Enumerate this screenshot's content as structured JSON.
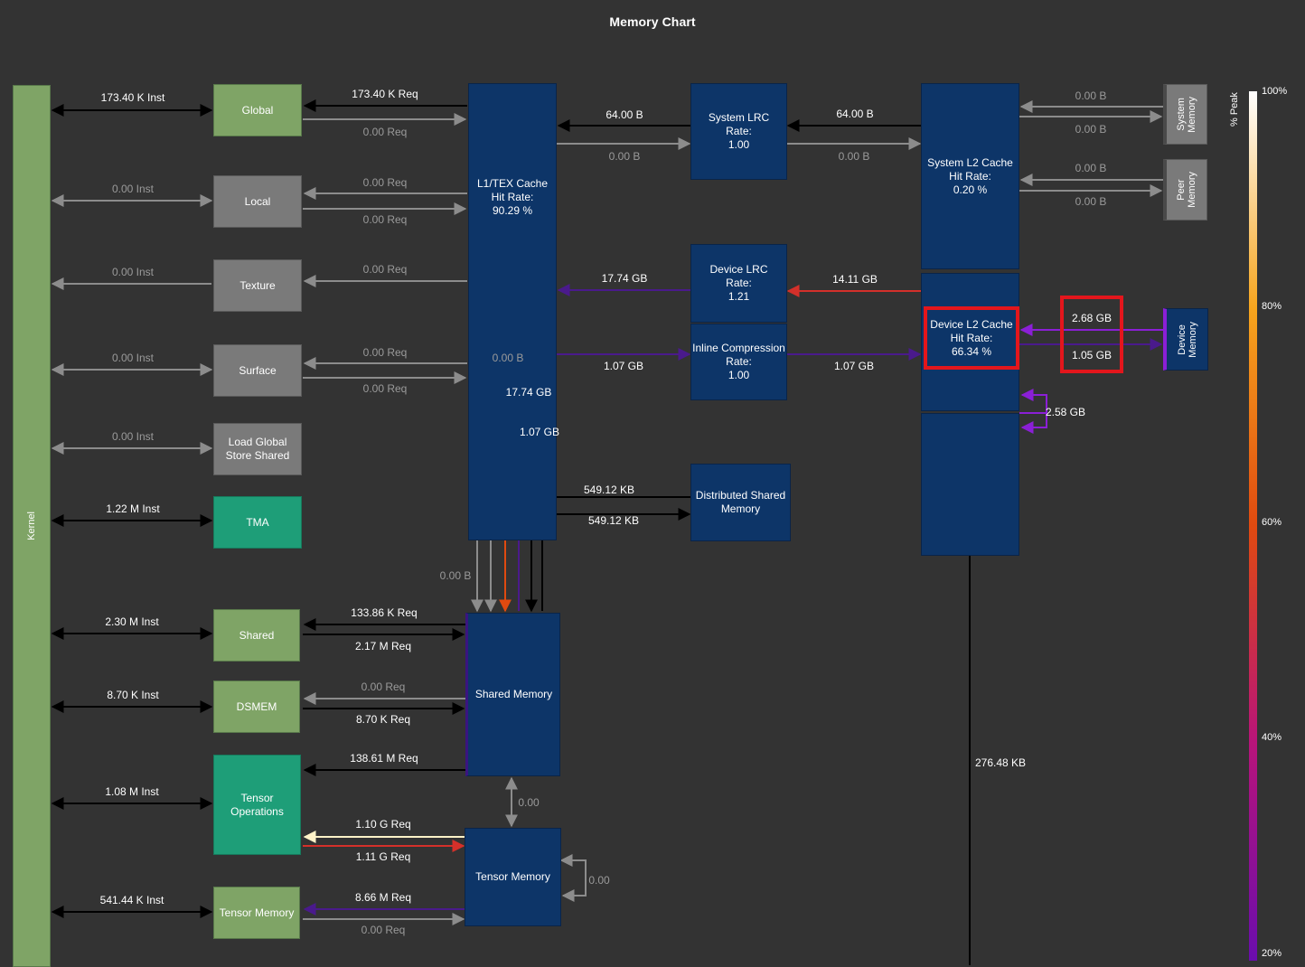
{
  "title": "Memory Chart",
  "colors": {
    "background": "#333333",
    "black": "#000000",
    "gray": "#8c8c8c",
    "purple": "#4a1a8c",
    "violet": "#8b1fd6",
    "red": "#d4302a",
    "orange": "#e04a10",
    "cream": "#fff3c8",
    "highlight": "#e3161c"
  },
  "units": {
    "nodes": [
      {
        "label": "Kernel"
      },
      {
        "label": "Global"
      },
      {
        "label": "Local"
      },
      {
        "label": "Texture"
      },
      {
        "label": "Surface"
      },
      {
        "label": "Load Global\nStore Shared"
      },
      {
        "label": "TMA"
      },
      {
        "label": "Shared"
      },
      {
        "label": "DSMEM"
      },
      {
        "label": "Tensor\nOperations"
      },
      {
        "label": "Tensor Memory"
      }
    ]
  },
  "caches": {
    "l1tex": "L1/TEX Cache\nHit Rate:\n90.29 %",
    "sys_lrc": "System LRC\nRate:\n1.00",
    "dev_lrc": "Device LRC\nRate:\n1.21",
    "inline": "Inline Compression\nRate:\n1.00",
    "dsm": "Distributed Shared\nMemory",
    "sys_l2": "System L2 Cache\nHit Rate:\n0.20 %",
    "dev_l2": "Device L2 Cache\nHit Rate:\n66.34 %",
    "shared_mem": "Shared Memory",
    "tensor_mem": "Tensor Memory",
    "system_memory": "System\nMemory",
    "peer_memory": "Peer\nMemory",
    "device_memory": "Device\nMemory"
  },
  "labels": {
    "global_inst": "173.40 K Inst",
    "global_req": "173.40 K Req",
    "global_req_w": "0.00  Req",
    "local_inst": "0.00  Inst",
    "local_req_r": "0.00  Req",
    "local_req_w": "0.00  Req",
    "tex_inst": "0.00  Inst",
    "tex_req": "0.00  Req",
    "surf_inst": "0.00  Inst",
    "surf_req_r": "0.00  Req",
    "surf_req_w": "0.00  Req",
    "lgss_inst": "0.00  Inst",
    "tma_inst": "1.22 M Inst",
    "shared_inst": "2.30 M Inst",
    "shared_req_r": "133.86 K Req",
    "shared_req_w": "2.17 M Req",
    "dsmem_inst": "8.70 K Inst",
    "dsmem_req_r": "0.00  Req",
    "dsmem_req_w": "8.70 K Req",
    "tops_inst": "1.08 M Inst",
    "tops_req1": "138.61 M Req",
    "tops_req2": "1.10 G Req",
    "tops_req3": "1.11 G Req",
    "tmem_inst": "541.44 K Inst",
    "tmem_req_r": "8.66 M Req",
    "tmem_req_w": "0.00  Req",
    "l1_sys_r": "64.00 B",
    "l1_sys_w": "0.00 B",
    "sys_l2_r": "64.00 B",
    "sys_l2_w": "0.00 B",
    "sysmem_r": "0.00 B",
    "sysmem_w": "0.00 B",
    "peer_r": "0.00 B",
    "peer_w": "0.00 B",
    "l1_devlrc": "17.74 GB",
    "devlrc_l2": "14.11 GB",
    "l1_inline": "1.07 GB",
    "inline_l2": "1.07 GB",
    "l1_inner_b": "0.00 B",
    "l1_inner_gb1": "17.74 GB",
    "l1_inner_gb2": "1.07 GB",
    "dsm_in": "549.12 KB",
    "dsm_out": "549.12 KB",
    "l1_shared": "0.00 B",
    "devmem_r": "2.68 GB",
    "devmem_w": "1.05 GB",
    "l2_loop": "2.58 GB",
    "l2_down": "276.48 KB",
    "shm_tmem": "0.00",
    "tmem_loop": "0.00"
  },
  "colorbar": {
    "title": "% Peak",
    "ticks": [
      "100%",
      "80%",
      "60%",
      "40%",
      "20%"
    ]
  }
}
